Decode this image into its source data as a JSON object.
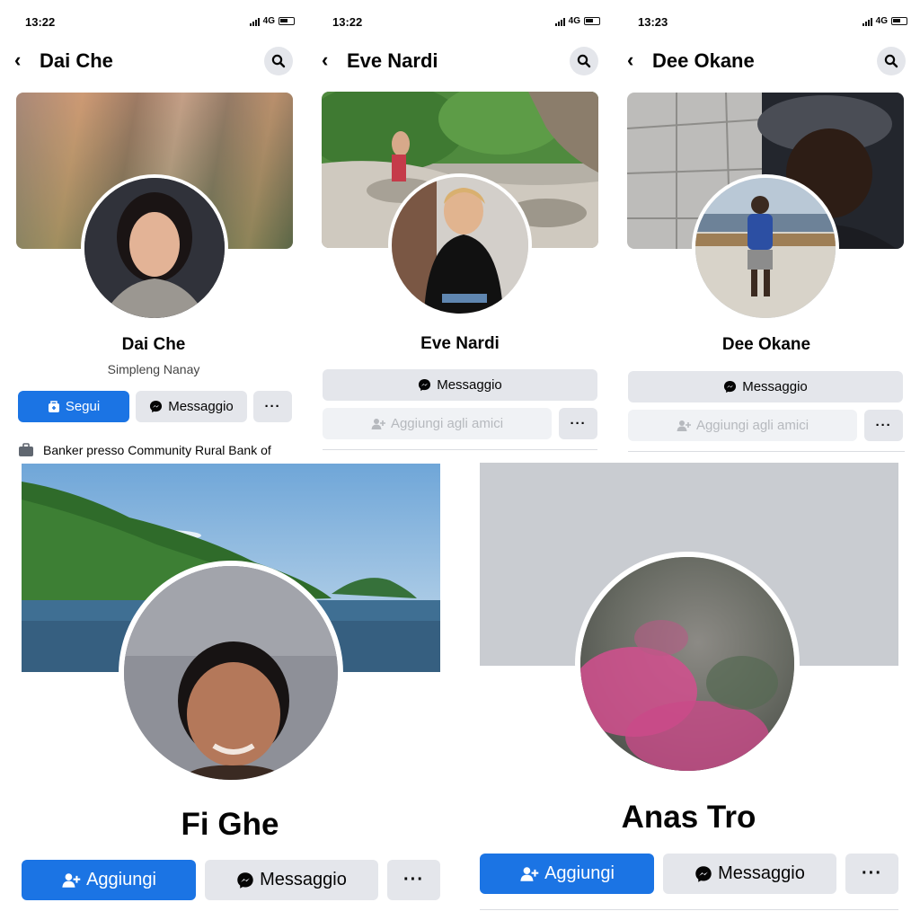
{
  "screens": [
    {
      "time": "13:22",
      "network": "4G",
      "title": "Dai Che",
      "name": "Dai Che",
      "subtitle": "Simpleng Nanay",
      "primary_button": "Segui",
      "message_button": "Messaggio",
      "more_button": "···",
      "work_prefix": "Banker presso",
      "work_place": "Community Rural Bank of"
    },
    {
      "time": "13:22",
      "network": "4G",
      "title": "Eve Nardi",
      "name": "Eve Nardi",
      "message_button": "Messaggio",
      "add_friend_button": "Aggiungi agli amici",
      "more_button": "···"
    },
    {
      "time": "13:23",
      "network": "4G",
      "title": "Dee Okane",
      "name": "Dee Okane",
      "message_button": "Messaggio",
      "add_friend_button": "Aggiungi agli amici",
      "more_button": "···"
    },
    {
      "name": "Fi Ghe",
      "add_button": "Aggiungi",
      "message_button": "Messaggio",
      "more_button": "···"
    },
    {
      "name": "Anas Tro",
      "add_button": "Aggiungi",
      "message_button": "Messaggio",
      "more_button": "···"
    }
  ],
  "icons": {
    "back": "chevron-left-icon",
    "search": "search-icon",
    "messenger": "messenger-icon",
    "follow": "follow-icon",
    "add_friend": "add-friend-icon",
    "work": "briefcase-icon"
  },
  "colors": {
    "primary_blue": "#1b74e4",
    "button_gray": "#e4e6eb",
    "disabled_gray": "#f0f2f5"
  }
}
